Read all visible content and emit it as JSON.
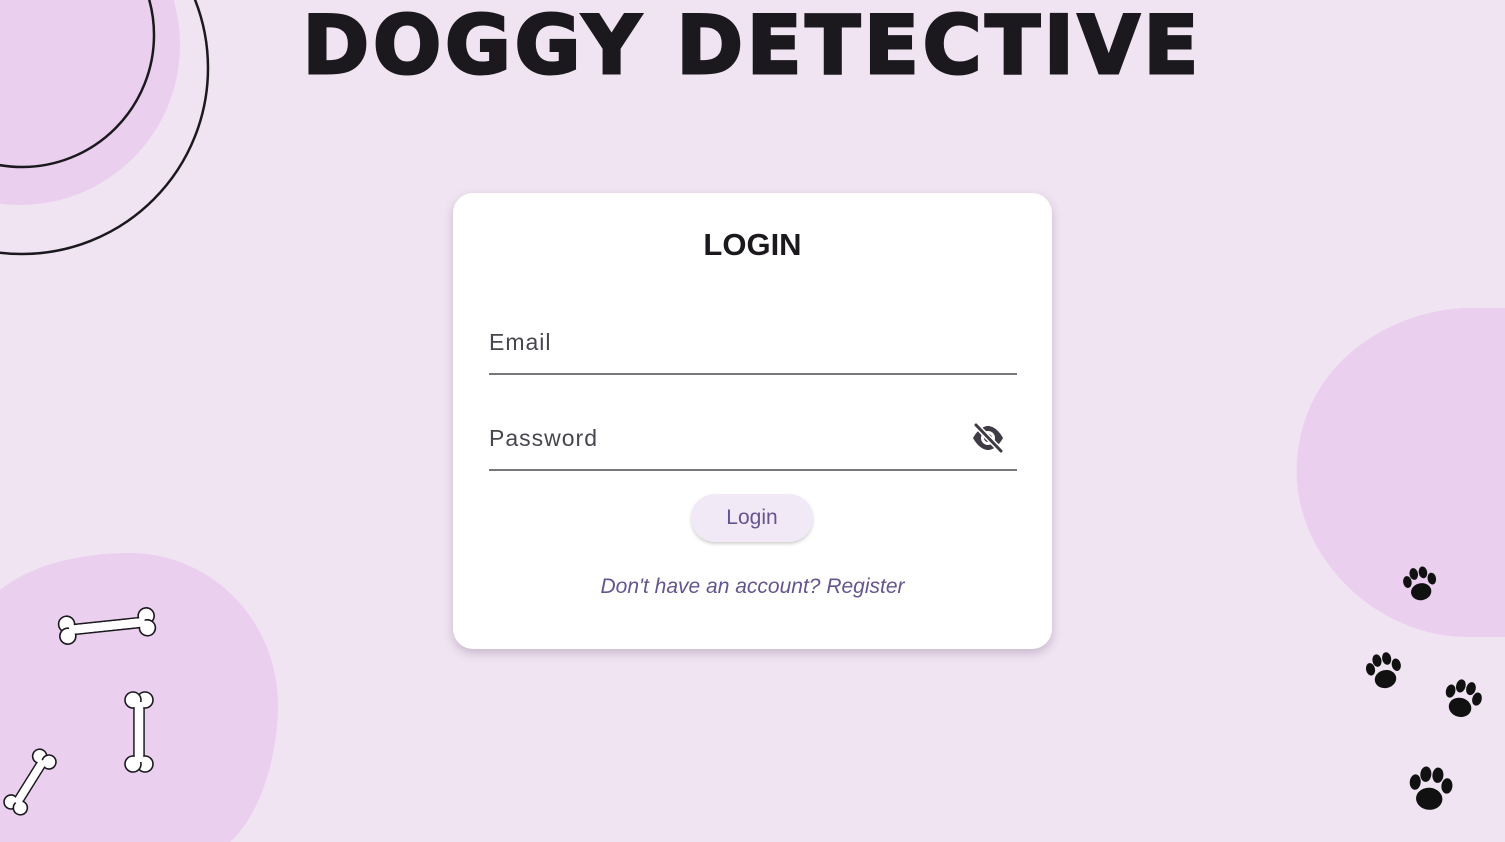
{
  "app": {
    "title": "Doggy Detective"
  },
  "login_card": {
    "title": "LOGIN",
    "email": {
      "placeholder": "Email",
      "value": ""
    },
    "password": {
      "placeholder": "Password",
      "value": "",
      "visibility_icon": "eye-off-icon"
    },
    "login_button_label": "Login",
    "register_link_text": "Don't have an account? Register"
  },
  "decorations": {
    "top_left": "circle-outline",
    "bottom_left": "bone-icons",
    "bottom_right": "paw-print-icons"
  },
  "colors": {
    "background": "#f0e4f2",
    "blob": "#ead0ee",
    "card": "#ffffff",
    "accent": "#65558f",
    "button_bg": "#f2e9f6",
    "text": "#1b191e"
  }
}
